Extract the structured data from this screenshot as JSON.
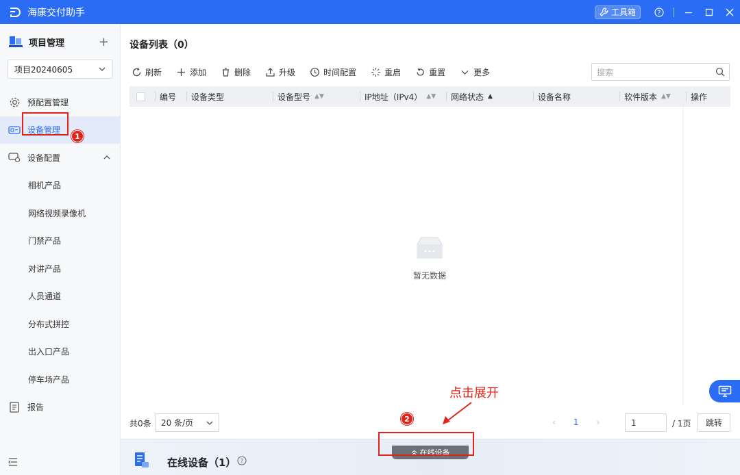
{
  "app": {
    "title": "海康交付助手",
    "toolbox_label": "工具箱"
  },
  "sidebar": {
    "project_title": "项目管理",
    "project_selected": "项目20240605",
    "items": [
      {
        "label": "预配置管理"
      },
      {
        "label": "设备管理"
      },
      {
        "label": "设备配置"
      },
      {
        "label": "相机产品"
      },
      {
        "label": "网络视频录像机"
      },
      {
        "label": "门禁产品"
      },
      {
        "label": "对讲产品"
      },
      {
        "label": "人员通道"
      },
      {
        "label": "分布式拼控"
      },
      {
        "label": "出入口产品"
      },
      {
        "label": "停车场产品"
      },
      {
        "label": "报告"
      }
    ]
  },
  "main": {
    "list_title": "设备列表（0）",
    "toolbar": {
      "refresh": "刷新",
      "add": "添加",
      "delete": "删除",
      "upgrade": "升级",
      "time_config": "时间配置",
      "reboot": "重启",
      "reset": "重置",
      "more": "更多"
    },
    "search_placeholder": "搜索",
    "columns": [
      "编号",
      "设备类型",
      "设备型号",
      "IP地址（IPv4）",
      "网络状态",
      "设备名称",
      "软件版本",
      "操作"
    ],
    "empty_text": "暂无数据",
    "pagination": {
      "total": "共0条",
      "page_size": "20 条/页",
      "current_page": "1",
      "page_input": "1",
      "total_pages": "/ 1页",
      "jump": "跳转"
    },
    "online_panel": {
      "title": "在线设备（1）",
      "expand_label": "在线设备"
    }
  },
  "annotations": {
    "badge1": "1",
    "badge2": "2",
    "hint": "点击展开"
  },
  "colors": {
    "primary": "#2a6df4",
    "annotation": "#e2231a"
  }
}
